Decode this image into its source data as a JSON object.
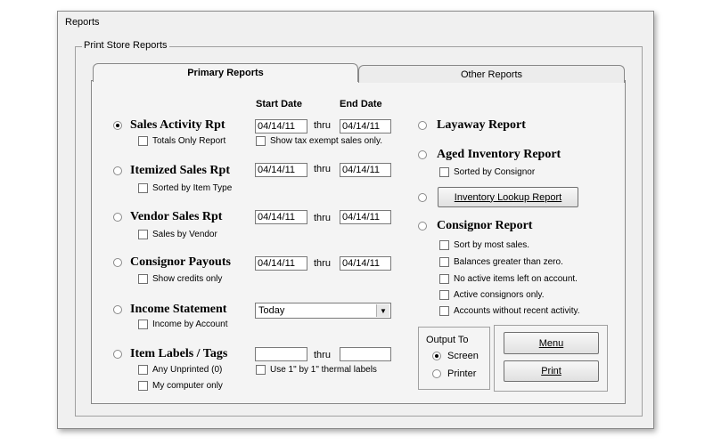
{
  "window": {
    "title": "Reports"
  },
  "group": {
    "caption": "Print Store Reports"
  },
  "tabs": {
    "primary": "Primary Reports",
    "other": "Other Reports"
  },
  "columns": {
    "start": "Start Date",
    "end": "End Date"
  },
  "left": {
    "sales_activity": {
      "label": "Sales Activity Rpt",
      "selected": true,
      "opt1": "Totals Only Report",
      "opt2": "Show tax exempt sales only.",
      "start": "04/14/11",
      "end": "04/14/11"
    },
    "itemized_sales": {
      "label": "Itemized Sales Rpt",
      "opt1": "Sorted by Item Type",
      "start": "04/14/11",
      "end": "04/14/11"
    },
    "vendor_sales": {
      "label": "Vendor Sales Rpt",
      "opt1": "Sales by Vendor",
      "start": "04/14/11",
      "end": "04/14/11"
    },
    "consignor_payouts": {
      "label": "Consignor Payouts",
      "opt1": "Show credits only",
      "start": "04/14/11",
      "end": "04/14/11"
    },
    "income_statement": {
      "label": "Income Statement",
      "opt1": "Income by Account",
      "period": "Today"
    },
    "item_labels": {
      "label": "Item Labels / Tags",
      "opt1": "Any Unprinted  (0)",
      "opt2": "My computer only",
      "opt3": "Use 1\" by 1\" thermal labels",
      "start": "",
      "end": ""
    }
  },
  "thru": "thru",
  "right": {
    "layaway": {
      "label": "Layaway Report"
    },
    "aged_inventory": {
      "label": "Aged Inventory Report",
      "opt1": "Sorted by Consignor"
    },
    "inventory_lookup": {
      "button": "Inventory Lookup Report"
    },
    "consignor_report": {
      "label": "Consignor Report",
      "opts": [
        "Sort by most sales.",
        "Balances greater than zero.",
        "No active items left on account.",
        "Active consignors only.",
        "Accounts without recent activity."
      ]
    }
  },
  "output": {
    "title": "Output To",
    "screen": "Screen",
    "printer": "Printer",
    "selected": "Screen"
  },
  "buttons": {
    "menu": "Menu",
    "print": "Print"
  }
}
